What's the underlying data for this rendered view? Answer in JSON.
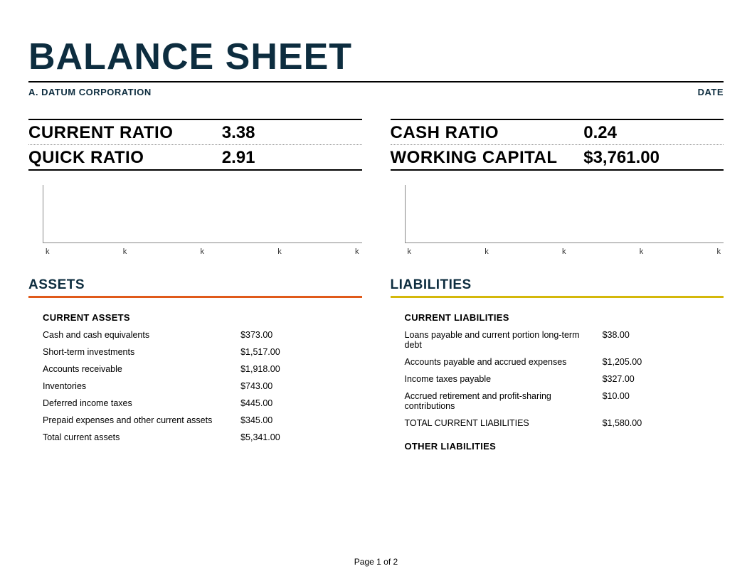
{
  "title": "BALANCE SHEET",
  "company": "A. DATUM CORPORATION",
  "date_label": "DATE",
  "ratios": {
    "left": [
      {
        "label": "CURRENT RATIO",
        "value": "3.38"
      },
      {
        "label": "QUICK RATIO",
        "value": "2.91"
      }
    ],
    "right": [
      {
        "label": "CASH RATIO",
        "value": "0.24"
      },
      {
        "label": "WORKING CAPITAL",
        "value": "$3,761.00"
      }
    ]
  },
  "chart_data": [
    {
      "type": "bar",
      "categories": [
        "k",
        "k",
        "k",
        "k",
        "k"
      ],
      "values": [],
      "title": "",
      "xlabel": "",
      "ylabel": ""
    },
    {
      "type": "bar",
      "categories": [
        "k",
        "k",
        "k",
        "k",
        "k"
      ],
      "values": [],
      "title": "",
      "xlabel": "",
      "ylabel": ""
    }
  ],
  "assets": {
    "header": "ASSETS",
    "current": {
      "title": "CURRENT ASSETS",
      "items": [
        {
          "label": "Cash and cash equivalents",
          "value": "$373.00"
        },
        {
          "label": "Short-term investments",
          "value": "$1,517.00"
        },
        {
          "label": "Accounts receivable",
          "value": "$1,918.00"
        },
        {
          "label": "Inventories",
          "value": "$743.00"
        },
        {
          "label": "Deferred income taxes",
          "value": "$445.00"
        },
        {
          "label": "Prepaid expenses and other current assets",
          "value": "$345.00"
        }
      ],
      "total": {
        "label": "Total current assets",
        "value": "$5,341.00"
      }
    }
  },
  "liabilities": {
    "header": "LIABILITIES",
    "current": {
      "title": "CURRENT LIABILITIES",
      "items": [
        {
          "label": "Loans payable and current portion long-term debt",
          "value": "$38.00"
        },
        {
          "label": "Accounts payable and accrued expenses",
          "value": "$1,205.00"
        },
        {
          "label": "Income taxes payable",
          "value": "$327.00"
        },
        {
          "label": "Accrued retirement and profit-sharing contributions",
          "value": "$10.00"
        }
      ],
      "total": {
        "label": "TOTAL CURRENT LIABILITIES",
        "value": "$1,580.00"
      }
    },
    "other": {
      "title": "OTHER LIABILITIES"
    }
  },
  "footer": "Page 1 of 2"
}
